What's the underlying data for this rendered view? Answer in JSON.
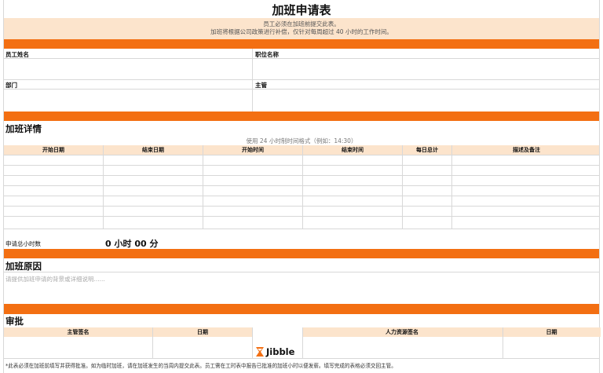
{
  "title": "加班申请表",
  "intro": {
    "line1": "员工必须在加班前提交此表。",
    "line2": "加班将根据公司政策进行补偿，仅针对每周超过 40 小时的工作时间。"
  },
  "employee": {
    "name_label": "员工姓名",
    "position_label": "职位名称",
    "department_label": "部门",
    "supervisor_label": "主管"
  },
  "details": {
    "heading": "加班详情",
    "time_format_note": "使用 24 小时制时间格式（例如：14:30）",
    "columns": [
      "开始日期",
      "结束日期",
      "开始时间",
      "结束时间",
      "每日总计",
      "描述及备注"
    ],
    "total_label": "申请总小时数",
    "total_value": "0 小时 00 分"
  },
  "reason": {
    "heading": "加班原因",
    "placeholder": "请提供加班申请的背景或详细说明......"
  },
  "approval": {
    "heading": "审批",
    "supervisor_signature": "主管签名",
    "date1": "日期",
    "hr_signature": "人力资源签名",
    "date2": "日期"
  },
  "brand": {
    "name": "Jibble",
    "icon": "hourglass-icon",
    "color": "#f36f12"
  },
  "footer": "*此表必须在加班前填写并获得批准。如为临时加班，请在加班发生的当周内提交此表。员工需在工时表中报告已批准的加班小时以便发薪。填写完成的表格必须交回主管。",
  "colors": {
    "accent": "#f36f12",
    "peach": "#fce4cc"
  }
}
